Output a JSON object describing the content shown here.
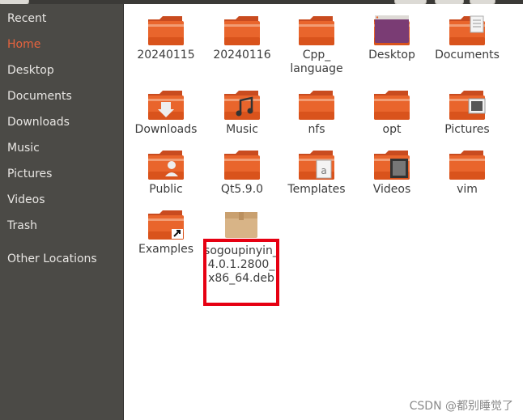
{
  "sidebar": {
    "items": [
      {
        "label": "Recent",
        "active": false
      },
      {
        "label": "Home",
        "active": true
      },
      {
        "label": "Desktop",
        "active": false
      },
      {
        "label": "Documents",
        "active": false
      },
      {
        "label": "Downloads",
        "active": false
      },
      {
        "label": "Music",
        "active": false
      },
      {
        "label": "Pictures",
        "active": false
      },
      {
        "label": "Videos",
        "active": false
      },
      {
        "label": "Trash",
        "active": false
      },
      {
        "label": "Other Locations",
        "active": false
      }
    ]
  },
  "files": [
    {
      "label": "20240115",
      "icon": "folder-icon"
    },
    {
      "label": "20240116",
      "icon": "folder-icon"
    },
    {
      "label": "Cpp_\nlanguage",
      "icon": "folder-icon"
    },
    {
      "label": "Desktop",
      "icon": "desktop-folder-icon"
    },
    {
      "label": "Documents",
      "icon": "documents-folder-icon"
    },
    {
      "label": "Downloads",
      "icon": "downloads-folder-icon"
    },
    {
      "label": "Music",
      "icon": "music-folder-icon"
    },
    {
      "label": "nfs",
      "icon": "folder-icon"
    },
    {
      "label": "opt",
      "icon": "folder-icon"
    },
    {
      "label": "Pictures",
      "icon": "pictures-folder-icon"
    },
    {
      "label": "Public",
      "icon": "public-folder-icon"
    },
    {
      "label": "Qt5.9.0",
      "icon": "folder-icon"
    },
    {
      "label": "Templates",
      "icon": "templates-folder-icon"
    },
    {
      "label": "Videos",
      "icon": "videos-folder-icon"
    },
    {
      "label": "vim",
      "icon": "folder-icon"
    },
    {
      "label": "Examples",
      "icon": "link-folder-icon"
    },
    {
      "label": "sogoupinyin_\n4.0.1.2800_\nx86_64.deb",
      "icon": "package-icon"
    }
  ],
  "watermark": "CSDN @都别睡觉了",
  "colors": {
    "sidebar_bg": "#4b4a46",
    "sidebar_active": "#e7633e",
    "folder_orange": "#e9652c",
    "highlight_border": "#e60012"
  }
}
